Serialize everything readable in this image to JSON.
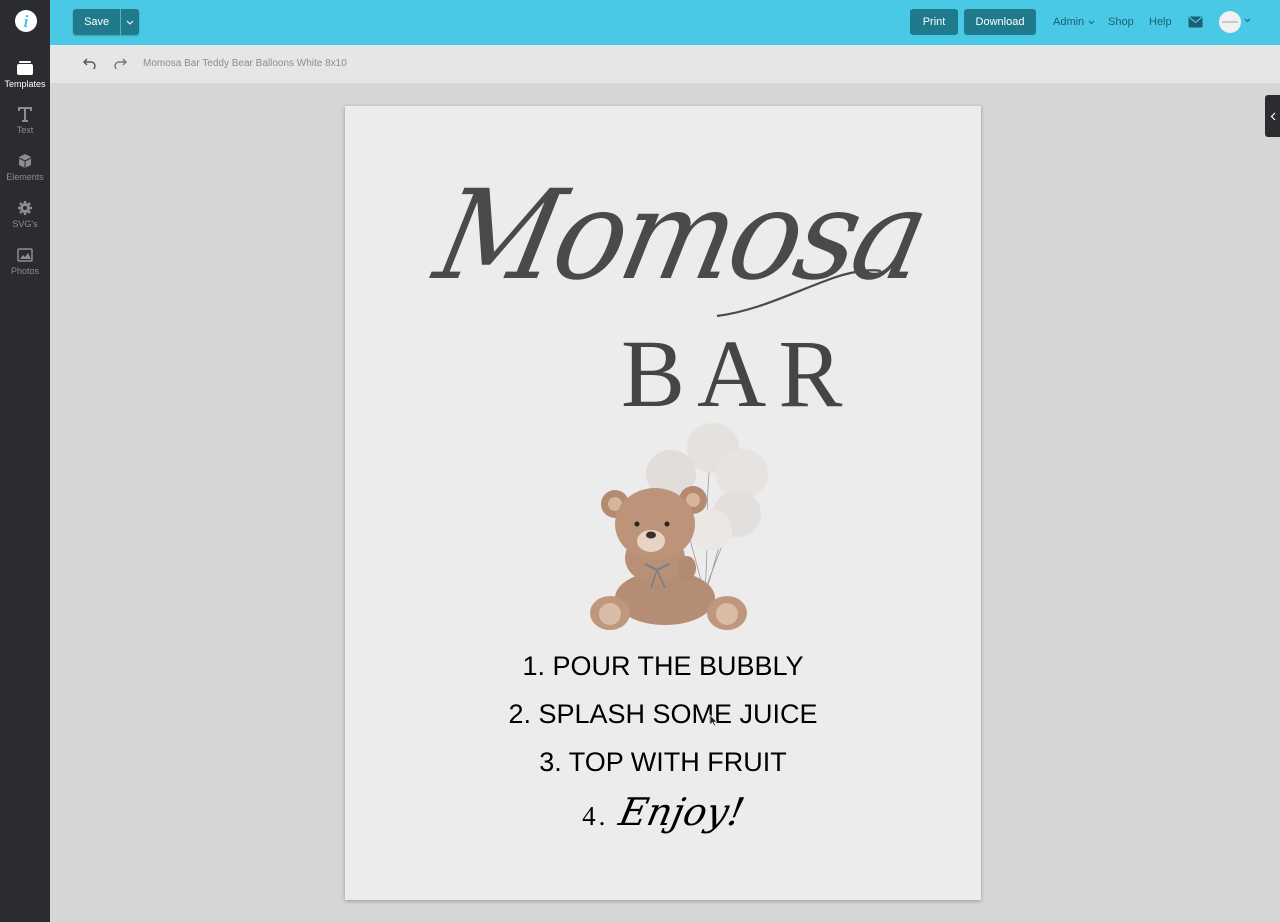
{
  "sidebar": {
    "items": [
      {
        "label": "Templates",
        "icon": "templates-icon"
      },
      {
        "label": "Text",
        "icon": "text-icon"
      },
      {
        "label": "Elements",
        "icon": "elements-icon"
      },
      {
        "label": "SVG's",
        "icon": "svg-icon"
      },
      {
        "label": "Photos",
        "icon": "photos-icon"
      }
    ]
  },
  "topbar": {
    "save_label": "Save",
    "print_label": "Print",
    "download_label": "Download",
    "admin_label": "Admin",
    "shop_label": "Shop",
    "help_label": "Help"
  },
  "toolbar": {
    "document_title": "Momosa Bar Teddy Bear Balloons White 8x10"
  },
  "canvas": {
    "script_title": "Momosa",
    "bar_title": "BAR",
    "steps": [
      "1. POUR THE BUBBLY",
      "2. SPLASH SOME JUICE",
      "3. TOP WITH FRUIT"
    ],
    "step4_number": "4.",
    "step4_word": "Enjoy!"
  },
  "colors": {
    "topbar": "#4ac9e6",
    "button": "#1f7a8c",
    "sidebar": "#2a2c2f",
    "page": "#ececec"
  }
}
